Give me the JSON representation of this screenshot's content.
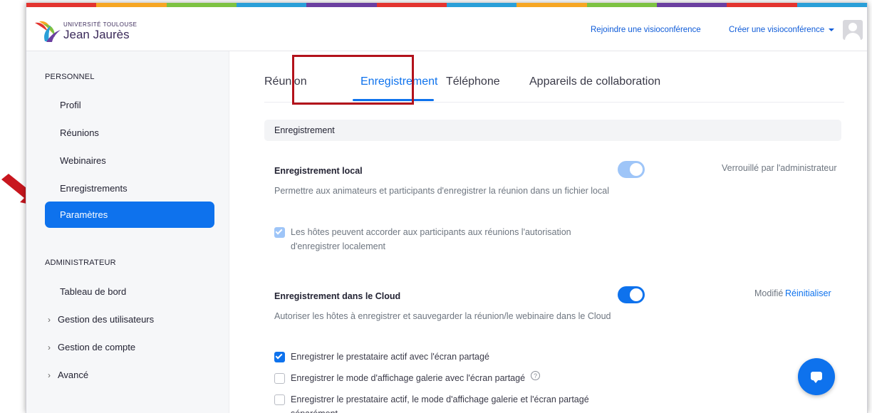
{
  "colors": {
    "accent": "#0e72ed",
    "highlight_border": "#b3121b",
    "arrow": "#c8161e",
    "stripes": [
      "#e3342f",
      "#f6a623",
      "#7dc242",
      "#2a9fd8",
      "#6b3fa0",
      "#e3342f",
      "#2a9fd8",
      "#f6a623",
      "#7dc242",
      "#6b3fa0",
      "#e3342f",
      "#2a9fd8"
    ]
  },
  "header": {
    "logo": {
      "line1": "UNIVERSITÉ TOULOUSE",
      "line2": "Jean Jaurès"
    },
    "join_link": "Rejoindre une visioconférence",
    "create_link": "Créer une visioconférence",
    "avatar_icon": "user-avatar-icon"
  },
  "sidebar": {
    "personal_heading": "PERSONNEL",
    "personal_items": [
      "Profil",
      "Réunions",
      "Webinaires",
      "Enregistrements",
      "Paramètres"
    ],
    "active_item": "Paramètres",
    "admin_heading": "ADMINISTRATEUR",
    "admin_items": [
      "Tableau de bord",
      "Gestion des utilisateurs",
      "Gestion de compte",
      "Avancé"
    ]
  },
  "tabs": [
    "Réunion",
    "Enregistrement",
    "Téléphone",
    "Appareils de collaboration"
  ],
  "active_tab": "Enregistrement",
  "section": {
    "title": "Enregistrement",
    "local": {
      "title": "Enregistrement local",
      "description": "Permettre aux animateurs et participants d'enregistrer la réunion dans un fichier local",
      "toggle_on": true,
      "locked_text": "Verrouillé par l'administrateur",
      "option": "Les hôtes peuvent accorder aux participants aux réunions l'autorisation d'enregistrer localement",
      "option_checked": true
    },
    "cloud": {
      "title": "Enregistrement dans le Cloud",
      "description": "Autoriser les hôtes à enregistrer et sauvegarder la réunion/le webinaire dans le Cloud",
      "toggle_on": true,
      "modified_text": "Modifié",
      "reset_link": "Réinitialiser",
      "options": [
        {
          "label": "Enregistrer le prestataire actif avec l'écran partagé",
          "checked": true
        },
        {
          "label": "Enregistrer le mode d'affichage galerie avec l'écran partagé",
          "checked": false,
          "help_icon": "?"
        },
        {
          "label": "Enregistrer le prestataire actif, le mode d'affichage galerie et l'écran partagé séparément",
          "checked": false
        }
      ]
    }
  },
  "chat_icon": "chat-bubble-icon"
}
